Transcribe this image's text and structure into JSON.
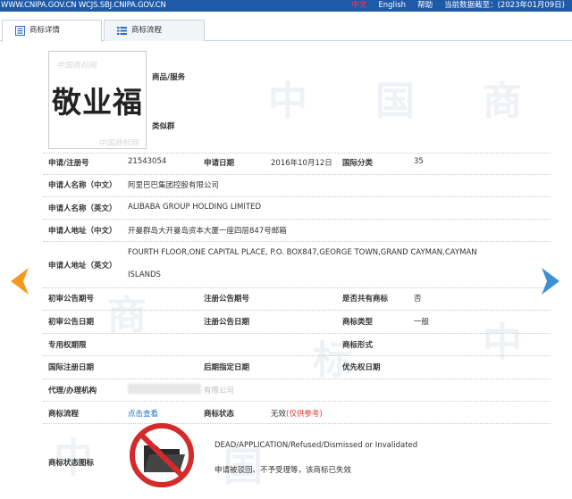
{
  "topbar": {
    "urls": "WWW.CNIPA.GOV.CN WCJS.SBJ.CNIPA.GOV.CN",
    "lang_cn": "中文",
    "lang_en": "English",
    "help": "帮助",
    "data_cutoff": "当前数据截至：(2023年01月09日)"
  },
  "tabs": [
    {
      "label": "商标详情",
      "icon": "document-icon"
    },
    {
      "label": "商标流程",
      "icon": "list-icon"
    }
  ],
  "trademark": {
    "name": "敬业福",
    "goods_services_label": "商品/服务",
    "similar_group_label": "类似群"
  },
  "details": {
    "reg_no_label": "申请/注册号",
    "reg_no": "21543054",
    "apply_date_label": "申请日期",
    "apply_date": "2016年10月12日",
    "intl_class_label": "国际分类",
    "intl_class": "35",
    "applicant_cn_label": "申请人名称（中文）",
    "applicant_cn": "阿里巴巴集团控股有限公司",
    "applicant_en_label": "申请人名称（英文）",
    "applicant_en": "ALIBABA GROUP HOLDING LIMITED",
    "address_cn_label": "申请人地址（中文）",
    "address_cn": "开曼群岛大开曼岛资本大厦一座四层847号邮箱",
    "address_en_label": "申请人地址（英文）",
    "address_en_line1": "FOURTH FLOOR,ONE CAPITAL PLACE, P.O. BOX847,GEORGE TOWN,GRAND CAYMAN,CAYMAN",
    "address_en_line2": "ISLANDS",
    "prelim_pub_no_label": "初审公告期号",
    "reg_pub_no_label": "注册公告期号",
    "shared_label": "是否共有商标",
    "shared": "否",
    "prelim_pub_date_label": "初审公告日期",
    "reg_pub_date_label": "注册公告日期",
    "mark_type_label": "商标类型",
    "mark_type": "一般",
    "exclusive_period_label": "专用权期限",
    "mark_form_label": "商标形式",
    "intl_reg_date_label": "国际注册日期",
    "later_designation_label": "后期指定日期",
    "priority_date_label": "优先权日期",
    "agent_label": "代理/办理机构",
    "agent_tail": "有限公司",
    "process_label": "商标流程",
    "process_link": "点击查看",
    "status_label": "商标状态",
    "status_prefix": "无效",
    "status_note": "(仅供参考)",
    "status_icon_label": "商标状态图标",
    "status_en": "DEAD/APPLICATION/Refused/Dismissed or Invalidated",
    "status_cn": "申请被驳回、不予受理等，该商标已失效"
  },
  "colors": {
    "topbar_bg": "#1f5aa8",
    "left_arrow": "#f39a1e",
    "right_arrow": "#3d8fd6",
    "status_red": "#d42a2a"
  }
}
